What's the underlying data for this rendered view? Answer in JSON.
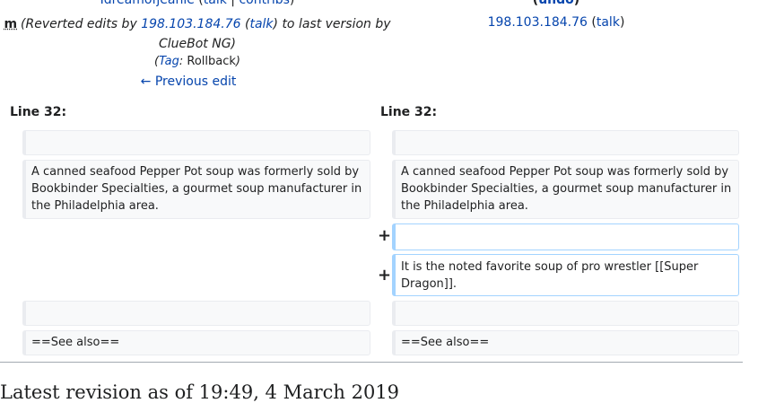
{
  "header_left": {
    "user": "Idreamofjeanie",
    "talk": "talk",
    "sep": "|",
    "contribs": "contribs",
    "minor_flag": "m",
    "summary_pre": "(Reverted edits by ",
    "summary_ip": "198.103.184.76",
    "summary_talk": "talk",
    "summary_post": ") to last version by ClueBot NG)",
    "summary_open_talk": " (",
    "tags_open": "(",
    "tag_label": "Tag",
    "tag_colon": ": ",
    "tag_value": "Rollback",
    "tags_close": ")",
    "previous_edit": "← Previous edit"
  },
  "header_right": {
    "undo_open": "(",
    "undo": "undo",
    "undo_close": ")",
    "ip": "198.103.184.76",
    "talk_open": " (",
    "talk": "talk",
    "talk_close": ")"
  },
  "diff": {
    "left_line": "Line 32:",
    "right_line": "Line 32:",
    "context_text": "A canned seafood Pepper Pot soup was formerly sold by Bookbinder Specialties, a gourmet soup manufacturer in the Philadelphia area.",
    "added_marker": "+",
    "added_text": "It is the noted favorite soup of pro wrestler [[Super Dragon]].",
    "see_also": "==See also=="
  },
  "latest_heading": "Latest revision as of 19:49, 4 March 2019"
}
